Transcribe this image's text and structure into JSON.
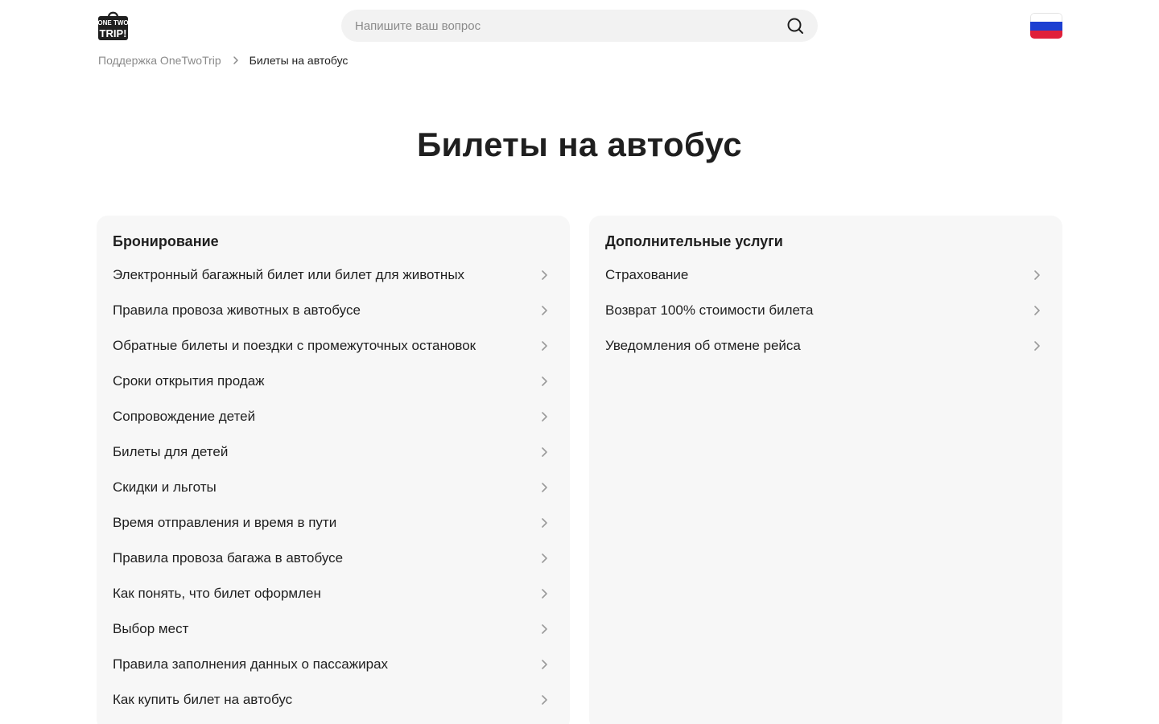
{
  "header": {
    "logo": {
      "line1": "ONE TWO",
      "line2": "TRIP!",
      "icon": "onetwotrip-logo"
    },
    "search": {
      "placeholder": "Напишите ваш вопрос",
      "value": "",
      "icon": "search-icon"
    },
    "language": {
      "icon": "russian-flag",
      "colors": [
        "#ffffff",
        "#1c3fd1",
        "#e0203a"
      ]
    }
  },
  "breadcrumb": {
    "home": "Поддержка OneTwoTrip",
    "current": "Билеты на автобус"
  },
  "page_title": "Билеты на автобус",
  "sections": [
    {
      "title": "Бронирование",
      "items": [
        "Электронный багажный билет или билет для животных",
        "Правила провоза животных в автобусе",
        "Обратные билеты и поездки с промежуточных остановок",
        "Сроки открытия продаж",
        "Сопровождение детей",
        "Билеты для детей",
        "Скидки и льготы",
        "Время отправления и время в пути",
        "Правила провоза багажа в автобусе",
        "Как понять, что билет оформлен",
        "Выбор мест",
        "Правила заполнения данных о пассажирах",
        "Как купить билет на автобус"
      ]
    },
    {
      "title": "Дополнительные услуги",
      "items": [
        "Страхование",
        "Возврат 100% стоимости билета",
        "Уведомления об отмене рейса"
      ]
    }
  ],
  "colors": {
    "text": "#1f1f1f",
    "muted": "#8a8a8a",
    "card_bg": "#f7f7f7",
    "search_bg": "#f2f2f2"
  }
}
